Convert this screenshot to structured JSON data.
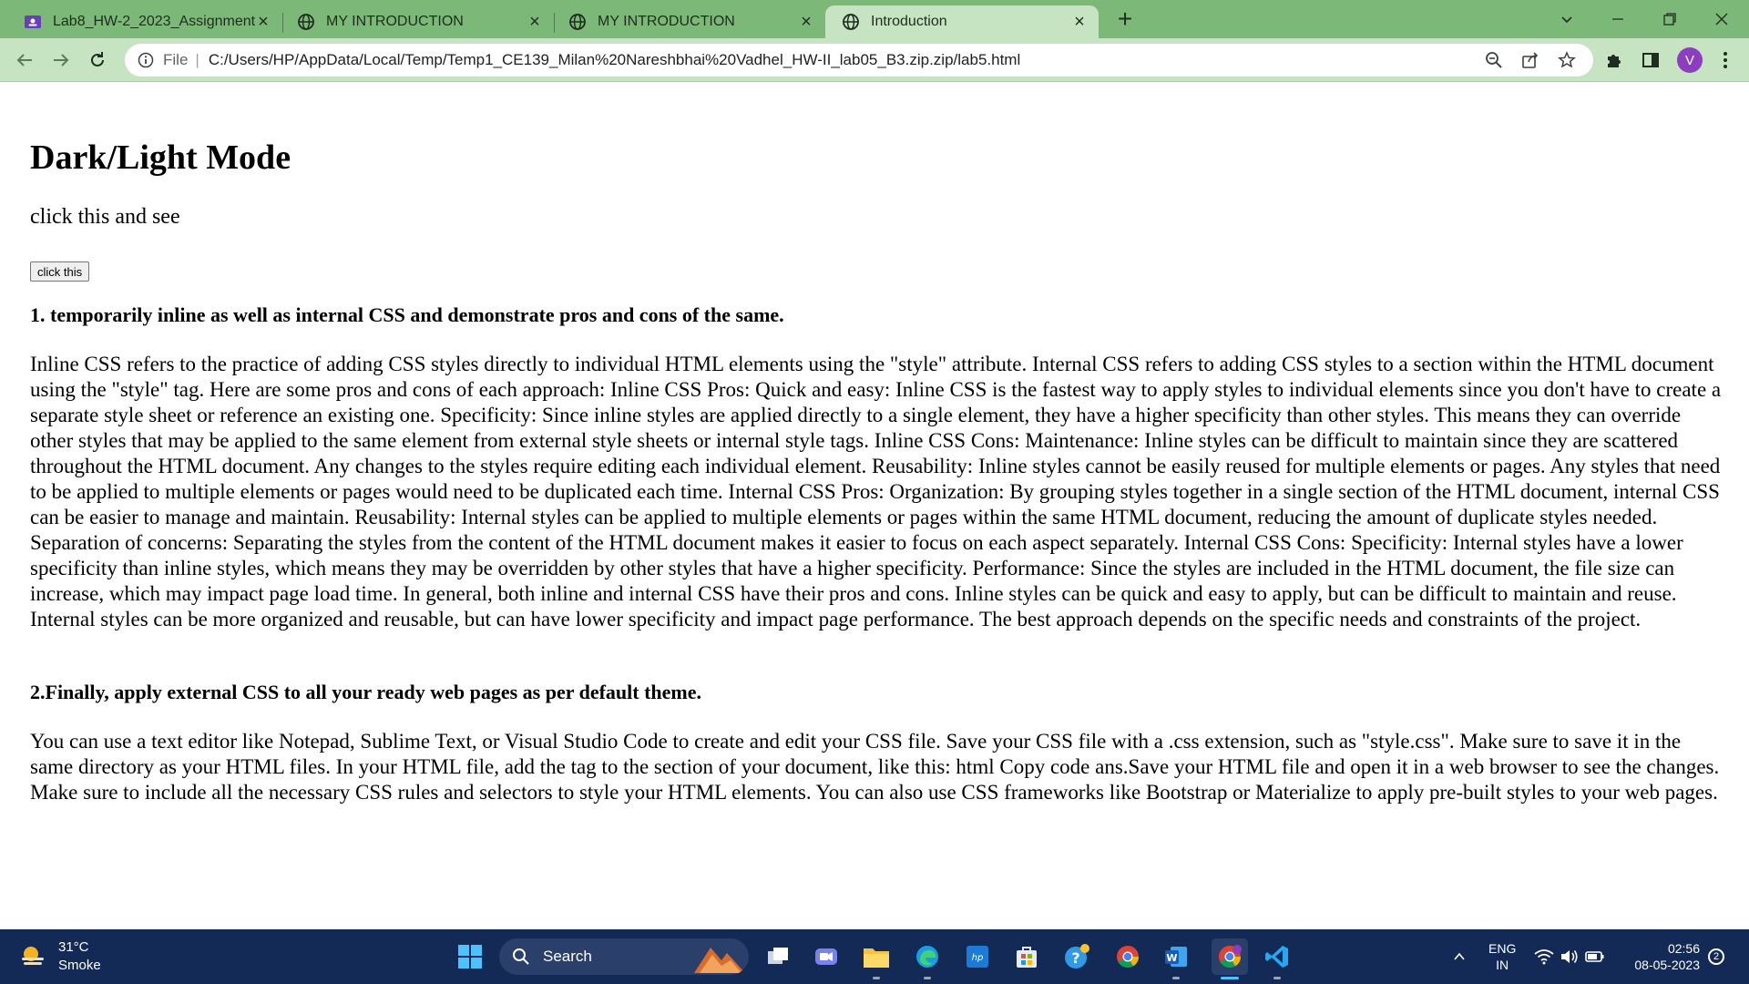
{
  "browser": {
    "tabs": [
      {
        "title": "Lab8_HW-2_2023_Assignment",
        "icon": "classroom-icon"
      },
      {
        "title": "MY INTRODUCTION",
        "icon": "globe-icon"
      },
      {
        "title": "MY INTRODUCTION",
        "icon": "globe-icon"
      },
      {
        "title": "Introduction",
        "icon": "globe-icon",
        "active": true
      }
    ],
    "address": {
      "scheme": "File",
      "url": "C:/Users/HP/AppData/Local/Temp/Temp1_CE139_Milan%20Nareshbhai%20Vadhel_HW-II_lab05_B3.zip.zip/lab5.html"
    },
    "profile_initial": "V",
    "accent_color": "#7cb877"
  },
  "page": {
    "title": "Dark/Light Mode",
    "subtitle": "click this and see",
    "button_label": "click this",
    "section1": {
      "heading": "1. temporarily inline as well as internal CSS and demonstrate pros and cons of the same.",
      "body": "Inline CSS refers to the practice of adding CSS styles directly to individual HTML elements using the \"style\" attribute. Internal CSS refers to adding CSS styles to a section within the HTML document using the \"style\" tag. Here are some pros and cons of each approach: Inline CSS Pros: Quick and easy: Inline CSS is the fastest way to apply styles to individual elements since you don't have to create a separate style sheet or reference an existing one. Specificity: Since inline styles are applied directly to a single element, they have a higher specificity than other styles. This means they can override other styles that may be applied to the same element from external style sheets or internal style tags. Inline CSS Cons: Maintenance: Inline styles can be difficult to maintain since they are scattered throughout the HTML document. Any changes to the styles require editing each individual element. Reusability: Inline styles cannot be easily reused for multiple elements or pages. Any styles that need to be applied to multiple elements or pages would need to be duplicated each time. Internal CSS Pros: Organization: By grouping styles together in a single section of the HTML document, internal CSS can be easier to manage and maintain. Reusability: Internal styles can be applied to multiple elements or pages within the same HTML document, reducing the amount of duplicate styles needed. Separation of concerns: Separating the styles from the content of the HTML document makes it easier to focus on each aspect separately. Internal CSS Cons: Specificity: Internal styles have a lower specificity than inline styles, which means they may be overridden by other styles that have a higher specificity. Performance: Since the styles are included in the HTML document, the file size can increase, which may impact page load time. In general, both inline and internal CSS have their pros and cons. Inline styles can be quick and easy to apply, but can be difficult to maintain and reuse. Internal styles can be more organized and reusable, but can have lower specificity and impact page performance. The best approach depends on the specific needs and constraints of the project."
    },
    "section2": {
      "heading": "2.Finally, apply external CSS to all your ready web pages as per default theme.",
      "body": "You can use a text editor like Notepad, Sublime Text, or Visual Studio Code to create and edit your CSS file. Save your CSS file with a .css extension, such as \"style.css\". Make sure to save it in the same directory as your HTML files. In your HTML file, add the tag to the section of your document, like this: html Copy code ans.Save your HTML file and open it in a web browser to see the changes. Make sure to include all the necessary CSS rules and selectors to style your HTML elements. You can also use CSS frameworks like Bootstrap or Materialize to apply pre-built styles to your web pages."
    }
  },
  "taskbar": {
    "weather": {
      "temp": "31°C",
      "condition": "Smoke"
    },
    "search_label": "Search",
    "language": {
      "lang": "ENG",
      "region": "IN"
    },
    "clock": {
      "time": "02:56",
      "date": "08-05-2023"
    },
    "notification_count": "2",
    "background_color": "#132a56"
  }
}
